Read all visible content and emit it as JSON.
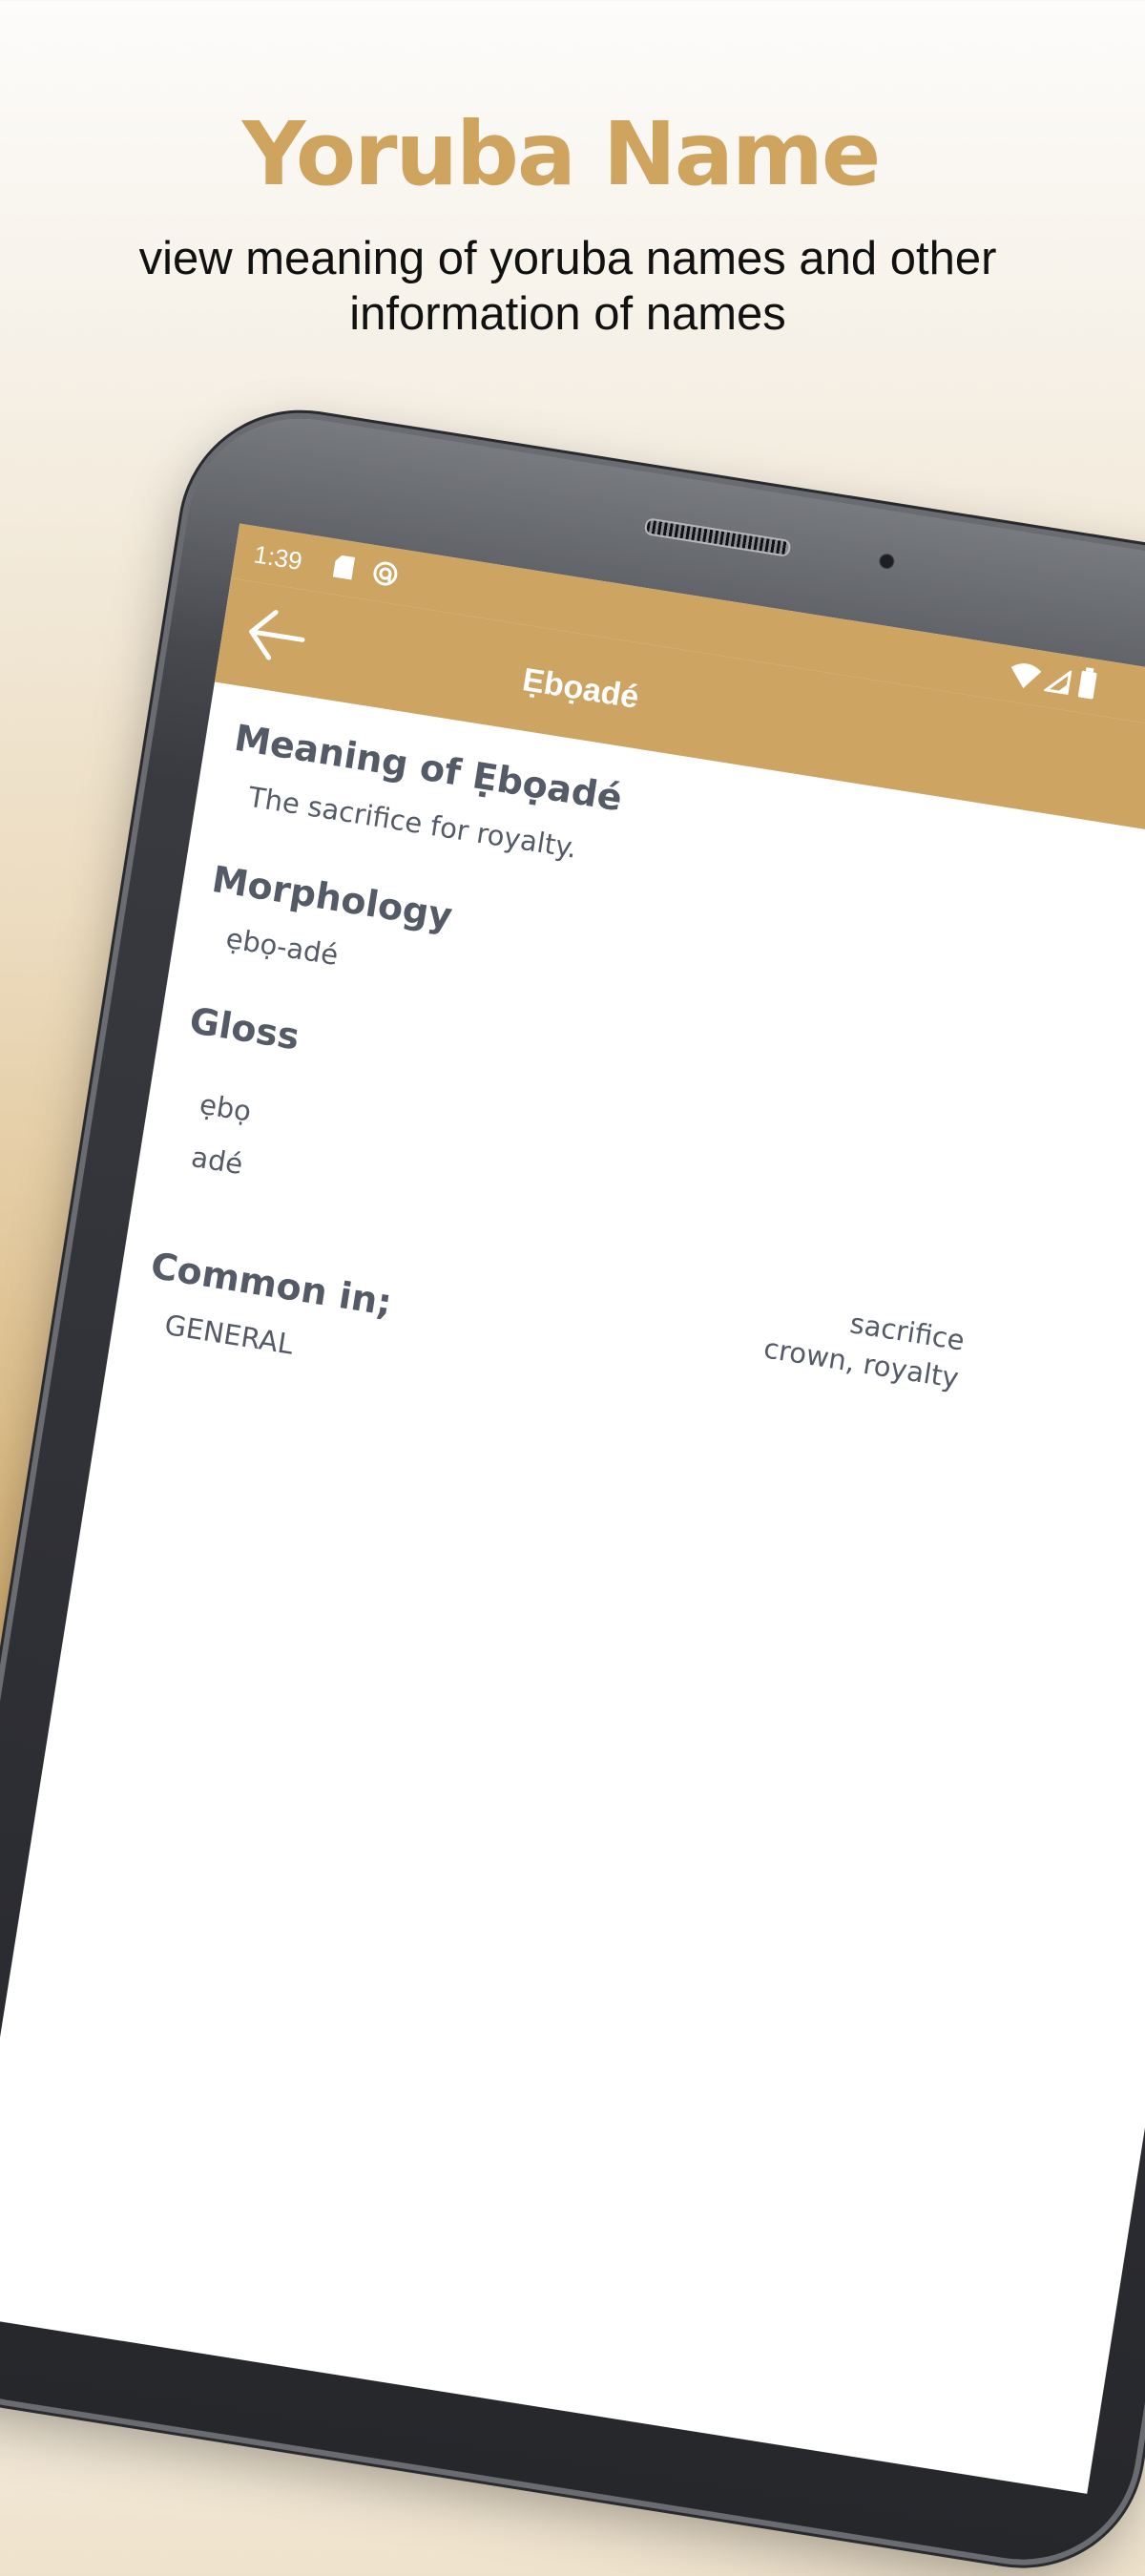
{
  "promo": {
    "title": "Yoruba Name",
    "subtitle": "view meaning of yoruba names and other information of names"
  },
  "status_bar": {
    "time": "1:39",
    "icons": [
      "sd-card-icon",
      "sync-icon",
      "wifi-icon",
      "signal-icon",
      "battery-icon"
    ]
  },
  "app_bar": {
    "back_icon": "arrow-left-icon",
    "title": "Ẹbọadé"
  },
  "content": {
    "meaning_heading": "Meaning of Ẹbọadé",
    "meaning_text": "The sacrifice for royalty.",
    "morphology_heading": "Morphology",
    "morphology_text": "ẹbọ-adé",
    "gloss_heading": "Gloss",
    "gloss": [
      {
        "term": "ẹbọ",
        "meaning": "sacrifice"
      },
      {
        "term": "adé",
        "meaning": "crown, royalty"
      }
    ],
    "common_heading": "Common in;",
    "common_text": "GENERAL"
  },
  "colors": {
    "accent": "#cda462",
    "title_gold": "#cfa45f",
    "text_gray": "#545b66"
  }
}
